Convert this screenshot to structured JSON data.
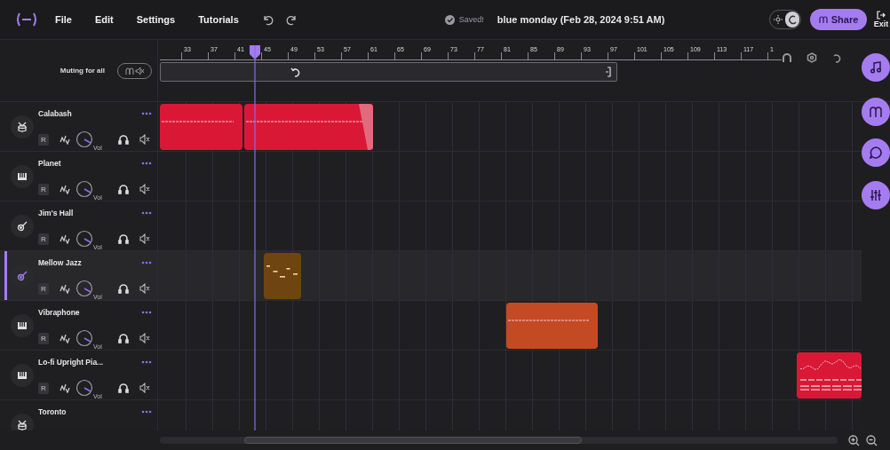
{
  "menu": [
    "File",
    "Edit",
    "Settings",
    "Tutorials"
  ],
  "save_status": "Saved!",
  "project_title": "blue monday (Feb 28, 2024 9:51 AM)",
  "theme_toggle": {
    "dark": true
  },
  "share_button": "Share",
  "exit_button": "Exit",
  "muting_label": "Muting for all",
  "mute_all": {
    "on": false
  },
  "ruler": {
    "ticks": [
      "33",
      "37",
      "41",
      "45",
      "49",
      "53",
      "57",
      "61",
      "65",
      "69",
      "73",
      "77",
      "81",
      "85",
      "89",
      "93",
      "97",
      "101",
      "105",
      "109",
      "113",
      "117",
      "1"
    ]
  },
  "tracks": [
    {
      "name": "Calabash",
      "kind": "drum",
      "selected": false,
      "record_label": "R",
      "knob_label": "Vol",
      "clips": [
        {
          "kind": "notes",
          "color": "#d91836"
        },
        {
          "kind": "notes",
          "color": "#d91836"
        }
      ]
    },
    {
      "name": "Planet",
      "kind": "keys",
      "selected": false,
      "record_label": "R",
      "knob_label": "Vol"
    },
    {
      "name": "Jim's Hall",
      "kind": "guitar",
      "selected": false,
      "record_label": "R",
      "knob_label": "Vol"
    },
    {
      "name": "Mellow Jazz",
      "kind": "guitar",
      "selected": true,
      "record_label": "R",
      "knob_label": "Vol",
      "clips": [
        {
          "kind": "notes",
          "color": "#6e4510"
        }
      ]
    },
    {
      "name": "Vibraphone",
      "kind": "keys",
      "selected": false,
      "record_label": "R",
      "knob_label": "Vol",
      "clips": [
        {
          "kind": "notes",
          "color": "#c44a24"
        }
      ]
    },
    {
      "name": "Lo-fi Upright Pia...",
      "kind": "keys",
      "selected": false,
      "record_label": "R",
      "knob_label": "Vol",
      "clips": [
        {
          "kind": "wave",
          "color": "#d91836"
        }
      ]
    },
    {
      "name": "Toronto",
      "kind": "drum",
      "selected": false
    }
  ]
}
